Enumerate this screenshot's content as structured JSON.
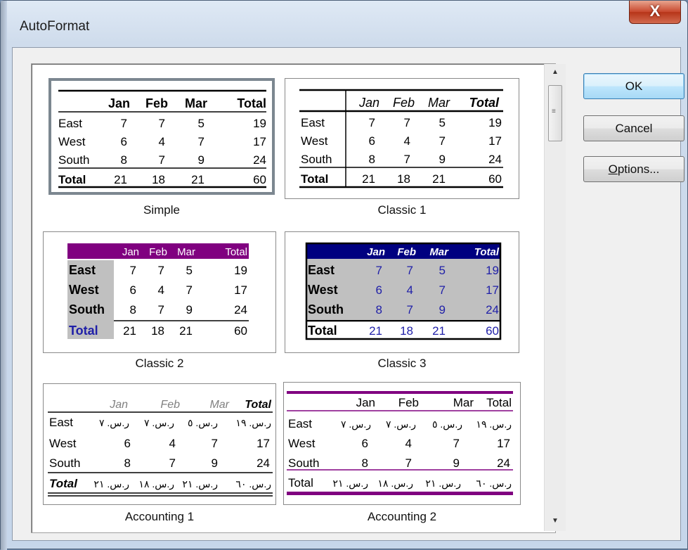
{
  "window": {
    "title": "AutoFormat",
    "close_glyph": "X"
  },
  "buttons": {
    "ok": "OK",
    "cancel": "Cancel",
    "options_mnemonic": "O",
    "options_rest": "ptions..."
  },
  "scrollbar": {
    "up": "▲",
    "down": "▼",
    "grip": "≡"
  },
  "formats": [
    {
      "name": "Simple",
      "header": [
        "Jan",
        "Feb",
        "Mar",
        "Total"
      ],
      "rows": [
        [
          "East",
          "7",
          "7",
          "5",
          "19"
        ],
        [
          "West",
          "6",
          "4",
          "7",
          "17"
        ],
        [
          "South",
          "8",
          "7",
          "9",
          "24"
        ],
        [
          "Total",
          "21",
          "18",
          "21",
          "60"
        ]
      ]
    },
    {
      "name": "Classic 1",
      "header": [
        "Jan",
        "Feb",
        "Mar",
        "Total"
      ],
      "rows": [
        [
          "East",
          "7",
          "7",
          "5",
          "19"
        ],
        [
          "West",
          "6",
          "4",
          "7",
          "17"
        ],
        [
          "South",
          "8",
          "7",
          "9",
          "24"
        ],
        [
          "Total",
          "21",
          "18",
          "21",
          "60"
        ]
      ]
    },
    {
      "name": "Classic 2",
      "header": [
        "Jan",
        "Feb",
        "Mar",
        "Total"
      ],
      "rows": [
        [
          "East",
          "7",
          "7",
          "5",
          "19"
        ],
        [
          "West",
          "6",
          "4",
          "7",
          "17"
        ],
        [
          "South",
          "8",
          "7",
          "9",
          "24"
        ],
        [
          "Total",
          "21",
          "18",
          "21",
          "60"
        ]
      ]
    },
    {
      "name": "Classic 3",
      "header": [
        "Jan",
        "Feb",
        "Mar",
        "Total"
      ],
      "rows": [
        [
          "East",
          "7",
          "7",
          "5",
          "19"
        ],
        [
          "West",
          "6",
          "4",
          "7",
          "17"
        ],
        [
          "South",
          "8",
          "7",
          "9",
          "24"
        ],
        [
          "Total",
          "21",
          "18",
          "21",
          "60"
        ]
      ]
    },
    {
      "name": "Accounting 1",
      "header": [
        "Jan",
        "Feb",
        "Mar",
        "Total"
      ],
      "rows": [
        [
          "East",
          "ر.س. ٧",
          "ر.س. ٧",
          "ر.س. ٥",
          "ر.س. ١٩"
        ],
        [
          "West",
          "6",
          "4",
          "7",
          "17"
        ],
        [
          "South",
          "8",
          "7",
          "9",
          "24"
        ],
        [
          "Total",
          "ر.س. ٢١",
          "ر.س. ١٨",
          "ر.س. ٢١",
          "ر.س. ٦٠"
        ]
      ]
    },
    {
      "name": "Accounting 2",
      "header": [
        "Jan",
        "Feb",
        "Mar",
        "Total"
      ],
      "rows": [
        [
          "East",
          "ر.س. ٧",
          "ر.س. ٧",
          "ر.س. ٥",
          "ر.س. ١٩"
        ],
        [
          "West",
          "6",
          "4",
          "7",
          "17"
        ],
        [
          "South",
          "8",
          "7",
          "9",
          "24"
        ],
        [
          "Total",
          "ر.س. ٢١",
          "ر.س. ١٨",
          "ر.س. ٢١",
          "ر.س. ٦٠"
        ]
      ]
    }
  ],
  "colors": {
    "purple": "#800080",
    "navy": "#000080",
    "blue_text": "#1f1fa8",
    "grey_fill": "#c0c0c0",
    "selection_border": "#7c8790"
  }
}
